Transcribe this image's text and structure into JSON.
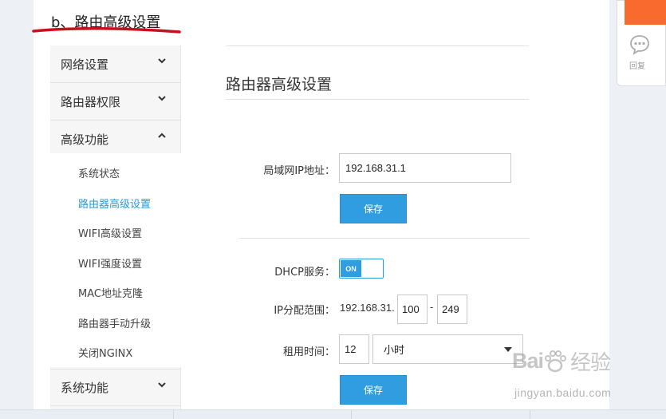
{
  "article": {
    "heading": "b、路由高级设置"
  },
  "sidebar": {
    "groups": [
      {
        "label": "网络设置",
        "expanded": false
      },
      {
        "label": "路由器权限",
        "expanded": false
      },
      {
        "label": "高级功能",
        "expanded": true
      },
      {
        "label": "系统功能",
        "expanded": false
      }
    ],
    "sub_items": [
      {
        "label": "系统状态",
        "active": false
      },
      {
        "label": "路由器高级设置",
        "active": true
      },
      {
        "label": "WIFI高级设置",
        "active": false
      },
      {
        "label": "WIFI强度设置",
        "active": false
      },
      {
        "label": "MAC地址克隆",
        "active": false
      },
      {
        "label": "路由器手动升级",
        "active": false
      },
      {
        "label": "关闭NGINX",
        "active": false
      }
    ]
  },
  "main": {
    "title": "路由器高级设置",
    "lan_ip": {
      "label": "局域网IP地址：",
      "value": "192.168.31.1"
    },
    "save_label": "保存",
    "dhcp": {
      "label": "DHCP服务：",
      "toggle": "ON"
    },
    "ip_range": {
      "label": "IP分配范围：",
      "prefix": "192.168.31.",
      "start": "100",
      "separator": "-",
      "end": "249"
    },
    "lease": {
      "label": "租用时间：",
      "value": "12",
      "unit": "小时"
    }
  },
  "right_widget": {
    "reply_label": "回复"
  },
  "watermark": {
    "logo_latin": "Bai",
    "logo_cn": "经验",
    "url": "jingyan.baidu.com"
  },
  "colors": {
    "accent": "#2f9de0",
    "active_link": "#2b9ad6",
    "orange": "#f86a2d",
    "underline": "#d0021b"
  }
}
